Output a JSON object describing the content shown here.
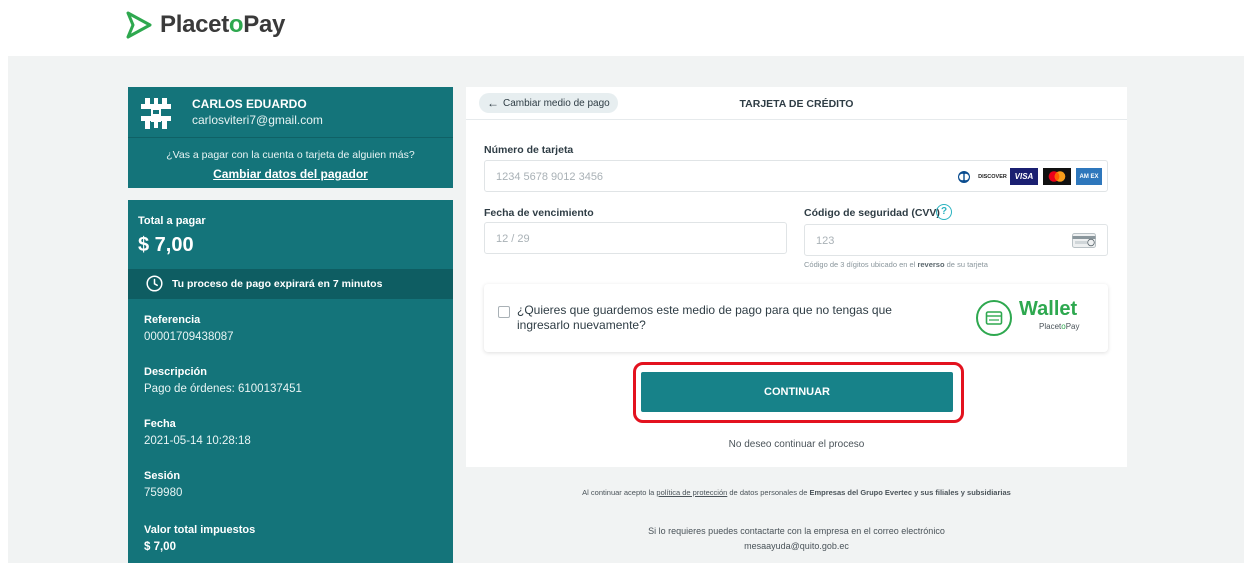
{
  "brand": {
    "logo_part1": "Placet",
    "logo_part2": "o",
    "logo_part3": "Pay"
  },
  "payer": {
    "name": "CARLOS EDUARDO",
    "email": "carlosviteri7@gmail.com",
    "question": "¿Vas a pagar con la cuenta o tarjeta de alguien más?",
    "change_link": "Cambiar datos del pagador"
  },
  "summary": {
    "total_label": "Total a pagar",
    "total_amount": "$ 7,00",
    "expire_text": "Tu proceso de pago expirará en 7 minutos",
    "items": [
      {
        "label": "Referencia",
        "value": "00001709438087"
      },
      {
        "label": "Descripción",
        "value": "Pago de órdenes: 6100137451"
      },
      {
        "label": "Fecha",
        "value": "2021-05-14 10:28:18"
      },
      {
        "label": "Sesión",
        "value": "759980"
      },
      {
        "label": "Valor total impuestos",
        "value": "$ 7,00"
      }
    ]
  },
  "payment": {
    "back_label": "Cambiar medio de pago",
    "title": "TARJETA DE CRÉDITO",
    "card_number_label": "Número de tarjeta",
    "card_number_placeholder": "1234 5678 9012 3456",
    "expiry_label": "Fecha de vencimiento",
    "expiry_placeholder": "12 / 29",
    "cvv_label": "Código de seguridad (CVV)",
    "cvv_placeholder": "123",
    "cvv_hint_prefix": "Código de 3 dígitos ubicado en el",
    "cvv_hint_bold": "reverso",
    "cvv_hint_suffix": "de su tarjeta",
    "brands": [
      "diners-club",
      "discover",
      "visa",
      "mastercard",
      "american-express"
    ],
    "brand_text": {
      "discover": "DISCOVER",
      "visa": "VISA",
      "amex": "AM EX"
    },
    "save_text": "¿Quieres que guardemos este medio de pago para que no tengas que ingresarlo nuevamente?",
    "wallet_word": "Wallet",
    "wallet_sub_1": "Placet",
    "wallet_sub_2": "o",
    "wallet_sub_3": "Pay",
    "continue_label": "CONTINUAR",
    "cancel_label": "No deseo continuar el proceso"
  },
  "footer": {
    "legal_prefix": "Al continuar acepto la",
    "legal_link": "política de protección",
    "legal_middle": "de datos personales de",
    "legal_bold": "Empresas del Grupo Evertec y sus filiales y subsidiarias",
    "contact_line1": "Si lo requieres puedes contactarte con la empresa en el correo electrónico",
    "contact_line2": "mesaayuda@quito.gob.ec"
  },
  "colors": {
    "primary": "#14747a",
    "button": "#178289",
    "accent_green": "#2ea84f",
    "highlight": "#e3121f"
  }
}
